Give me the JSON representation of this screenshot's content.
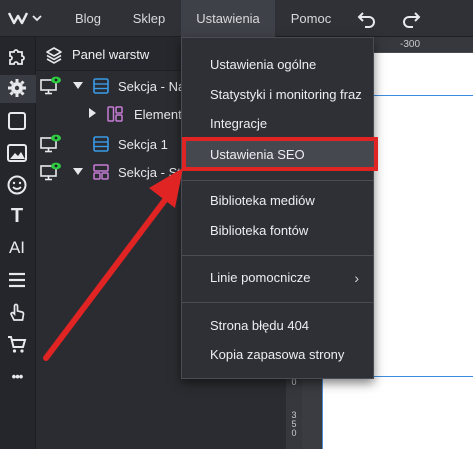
{
  "topbar": {
    "menus": [
      "Blog",
      "Sklep",
      "Ustawienia",
      "Pomoc"
    ]
  },
  "panel": {
    "title": "Panel warstw",
    "layers": [
      {
        "label": "Sekcja - Na"
      },
      {
        "label": "Element"
      },
      {
        "label": "Sekcja 1"
      },
      {
        "label": "Sekcja - St"
      }
    ]
  },
  "ruler": {
    "top_label": "-300",
    "left_labels": [
      "0",
      "3 5 0"
    ]
  },
  "dropdown": {
    "items": [
      "Ustawienia ogólne",
      "Statystyki i monitoring fraz",
      "Integracje",
      "Ustawienia SEO",
      "Biblioteka mediów",
      "Biblioteka fontów",
      "Linie pomocnicze",
      "Strona błędu 404",
      "Kopia zapasowa strony"
    ],
    "submenu_arrow": "›"
  },
  "sidebar": {
    "ai_label": "AI",
    "text_label": "T",
    "more_label": "•••"
  },
  "colors": {
    "accent": "#3b8edf",
    "highlight": "#e02424",
    "arrow": "#e02424",
    "icon_green": "#2ecc40",
    "section_blue": "#3b9be8",
    "section_purple": "#c77dd6"
  }
}
